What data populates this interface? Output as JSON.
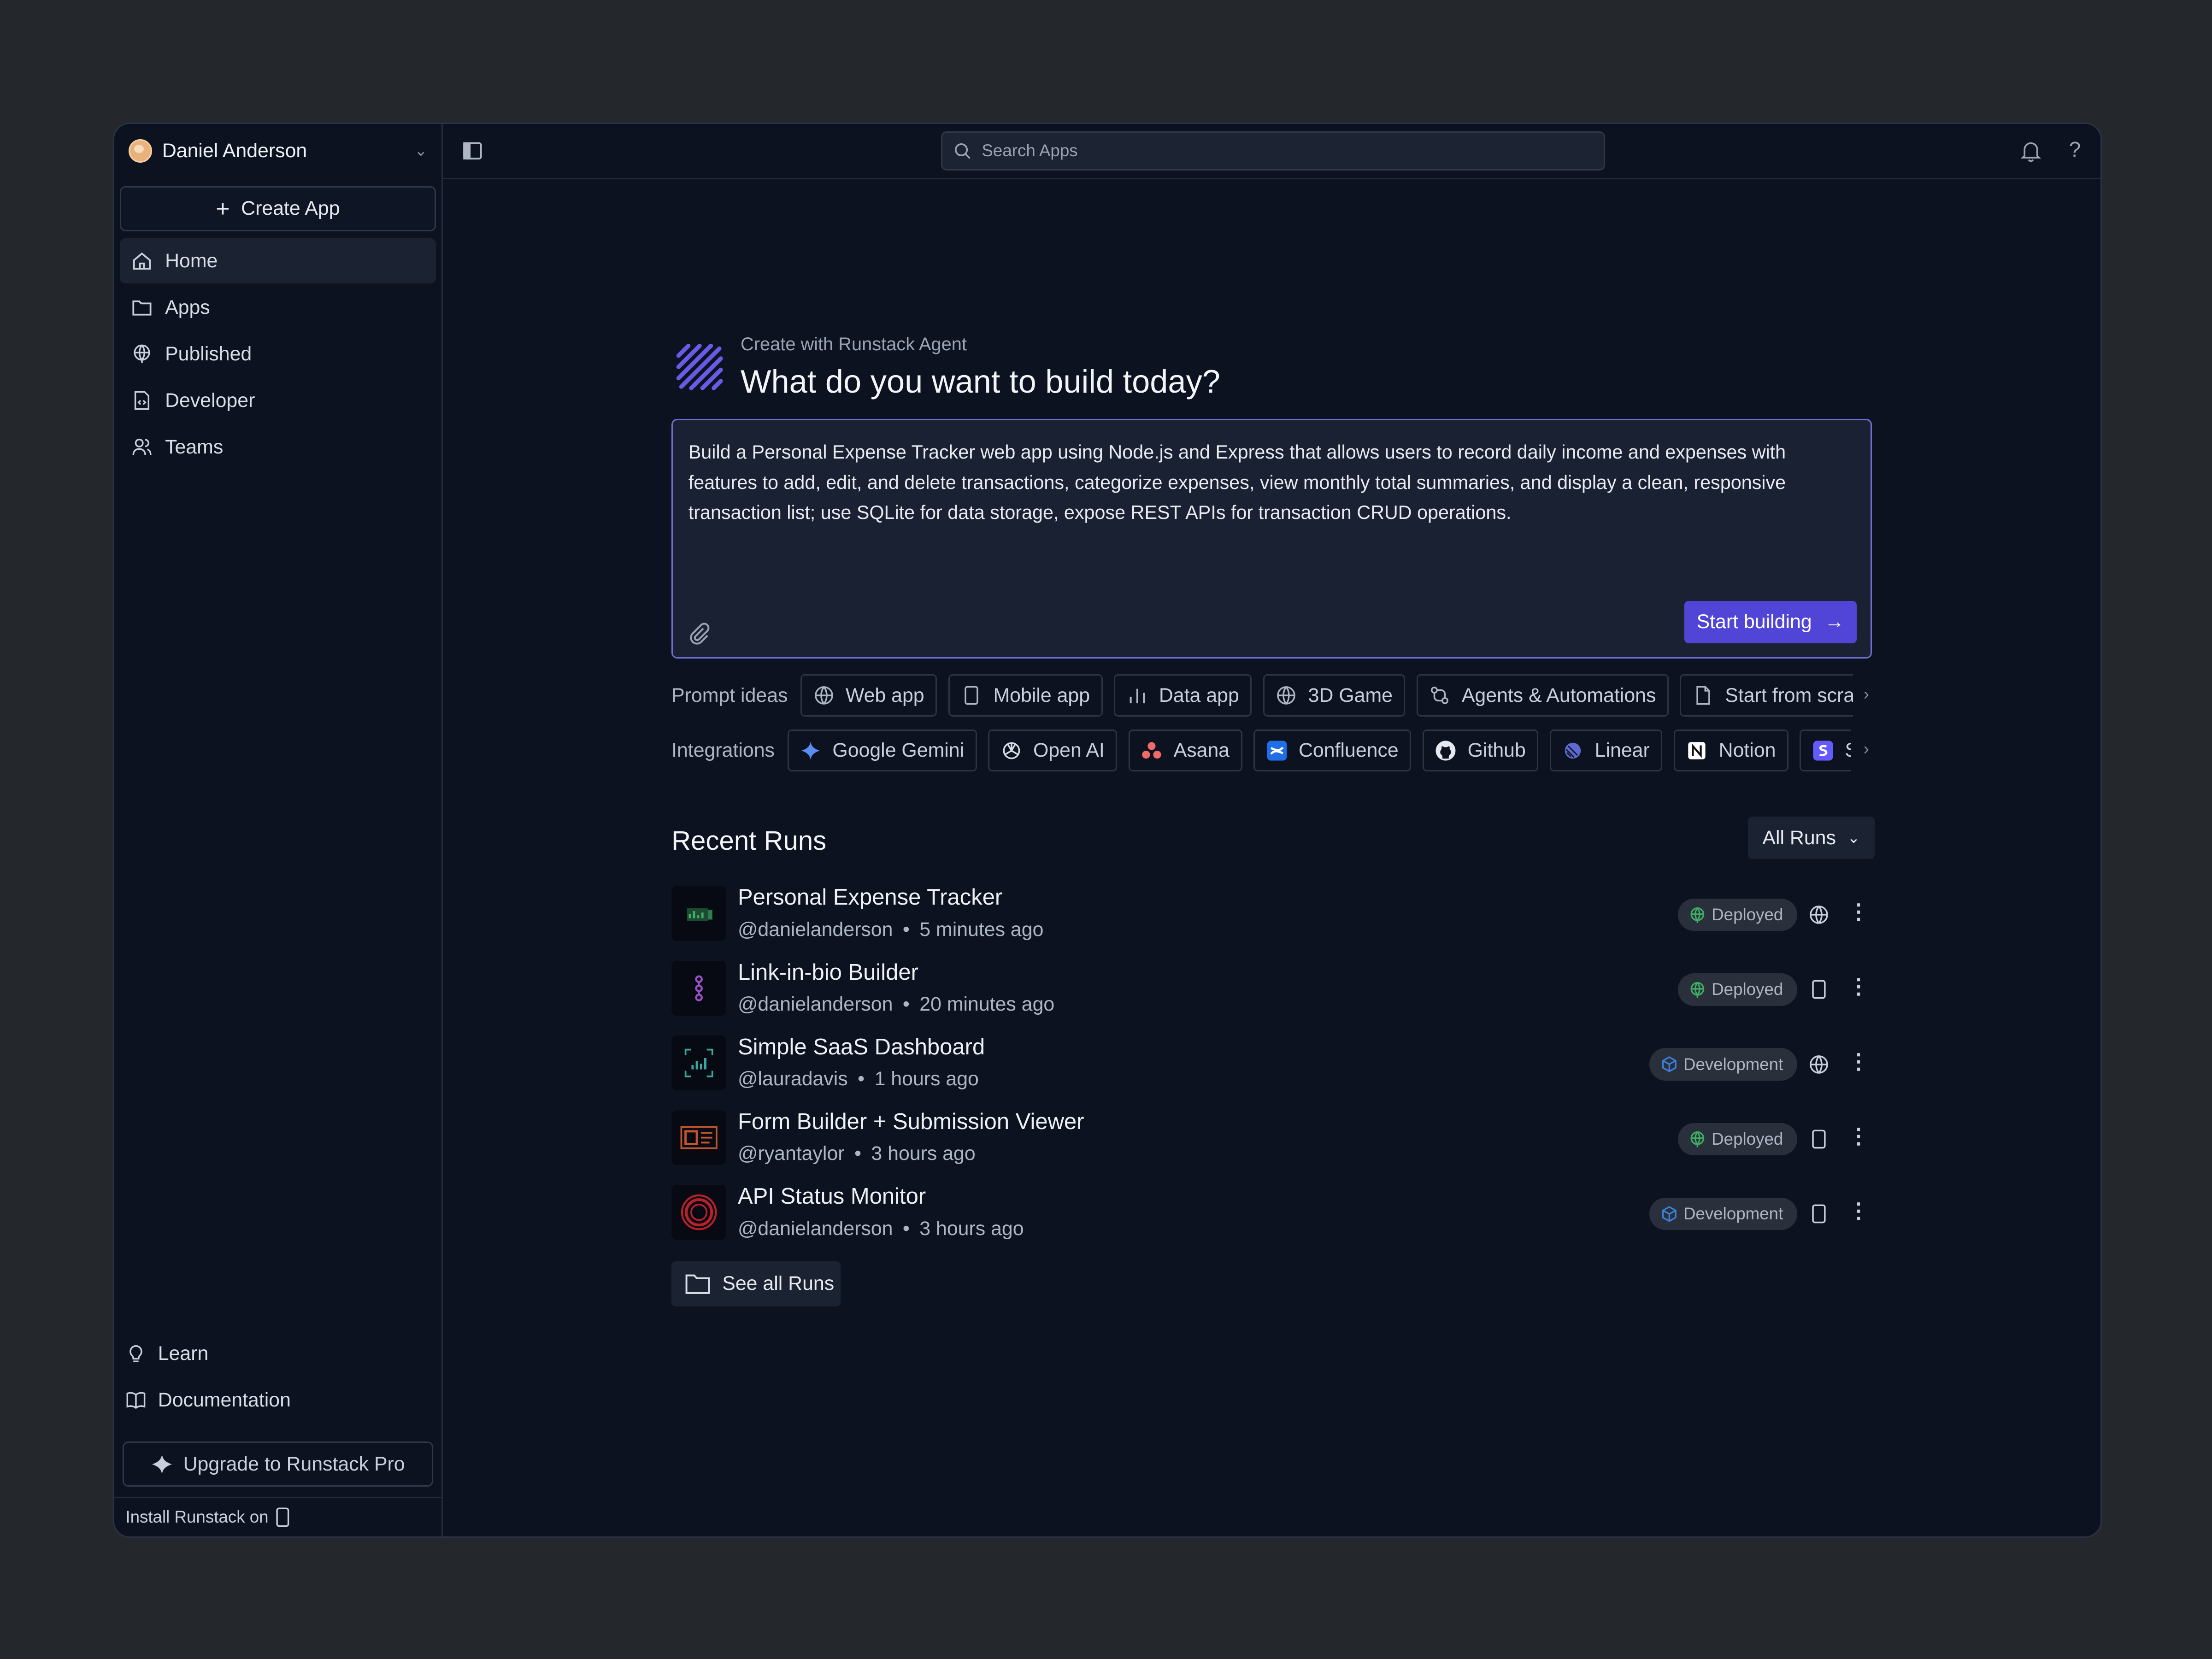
{
  "sidebar": {
    "user_name": "Daniel Anderson",
    "create_label": "Create App",
    "nav": [
      {
        "label": "Home",
        "icon": "home-icon"
      },
      {
        "label": "Apps",
        "icon": "folder-icon"
      },
      {
        "label": "Published",
        "icon": "globe-icon"
      },
      {
        "label": "Developer",
        "icon": "code-file-icon"
      },
      {
        "label": "Teams",
        "icon": "users-icon"
      }
    ],
    "learn": "Learn",
    "docs": "Documentation",
    "upgrade": "Upgrade to Runstack Pro",
    "install": "Install Runstack on"
  },
  "topbar": {
    "search_placeholder": "Search Apps",
    "help": "?"
  },
  "hero": {
    "subtitle": "Create with Runstack Agent",
    "title": "What do you want to build today?",
    "prompt": "Build a Personal Expense Tracker web app using Node.js and Express that allows users to record daily income and expenses with features to add, edit, and delete transactions, categorize expenses, view monthly total summaries, and display a clean, responsive transaction list; use SQLite for data storage, expose REST APIs for transaction CRUD operations.",
    "start_label": "Start building"
  },
  "prompt_ideas": {
    "label": "Prompt ideas",
    "items": [
      "Web app",
      "Mobile app",
      "Data app",
      "3D Game",
      "Agents & Automations",
      "Start from scratch"
    ]
  },
  "integrations": {
    "label": "Integrations",
    "items": [
      "Google Gemini",
      "Open AI",
      "Asana",
      "Confluence",
      "Github",
      "Linear",
      "Notion",
      "Stripe"
    ]
  },
  "recent": {
    "title": "Recent Runs",
    "filter": "All Runs",
    "see_all": "See all Runs",
    "runs": [
      {
        "title": "Personal Expense Tracker",
        "user": "@danielanderson",
        "time": "5 minutes ago",
        "status": "Deployed",
        "platform": "globe-icon"
      },
      {
        "title": "Link-in-bio Builder",
        "user": "@danielanderson",
        "time": "20 minutes ago",
        "status": "Deployed",
        "platform": "mobile-icon"
      },
      {
        "title": "Simple SaaS Dashboard",
        "user": "@lauradavis",
        "time": "1 hours ago",
        "status": "Development",
        "platform": "globe-icon"
      },
      {
        "title": "Form Builder + Submission Viewer",
        "user": "@ryantaylor",
        "time": "3 hours ago",
        "status": "Deployed",
        "platform": "mobile-icon"
      },
      {
        "title": "API Status Monitor",
        "user": "@danielanderson",
        "time": "3 hours ago",
        "status": "Development",
        "platform": "mobile-icon"
      }
    ]
  },
  "colors": {
    "accent": "#5145d8",
    "deployed": "#3fae63",
    "development": "#3d7fd8"
  }
}
